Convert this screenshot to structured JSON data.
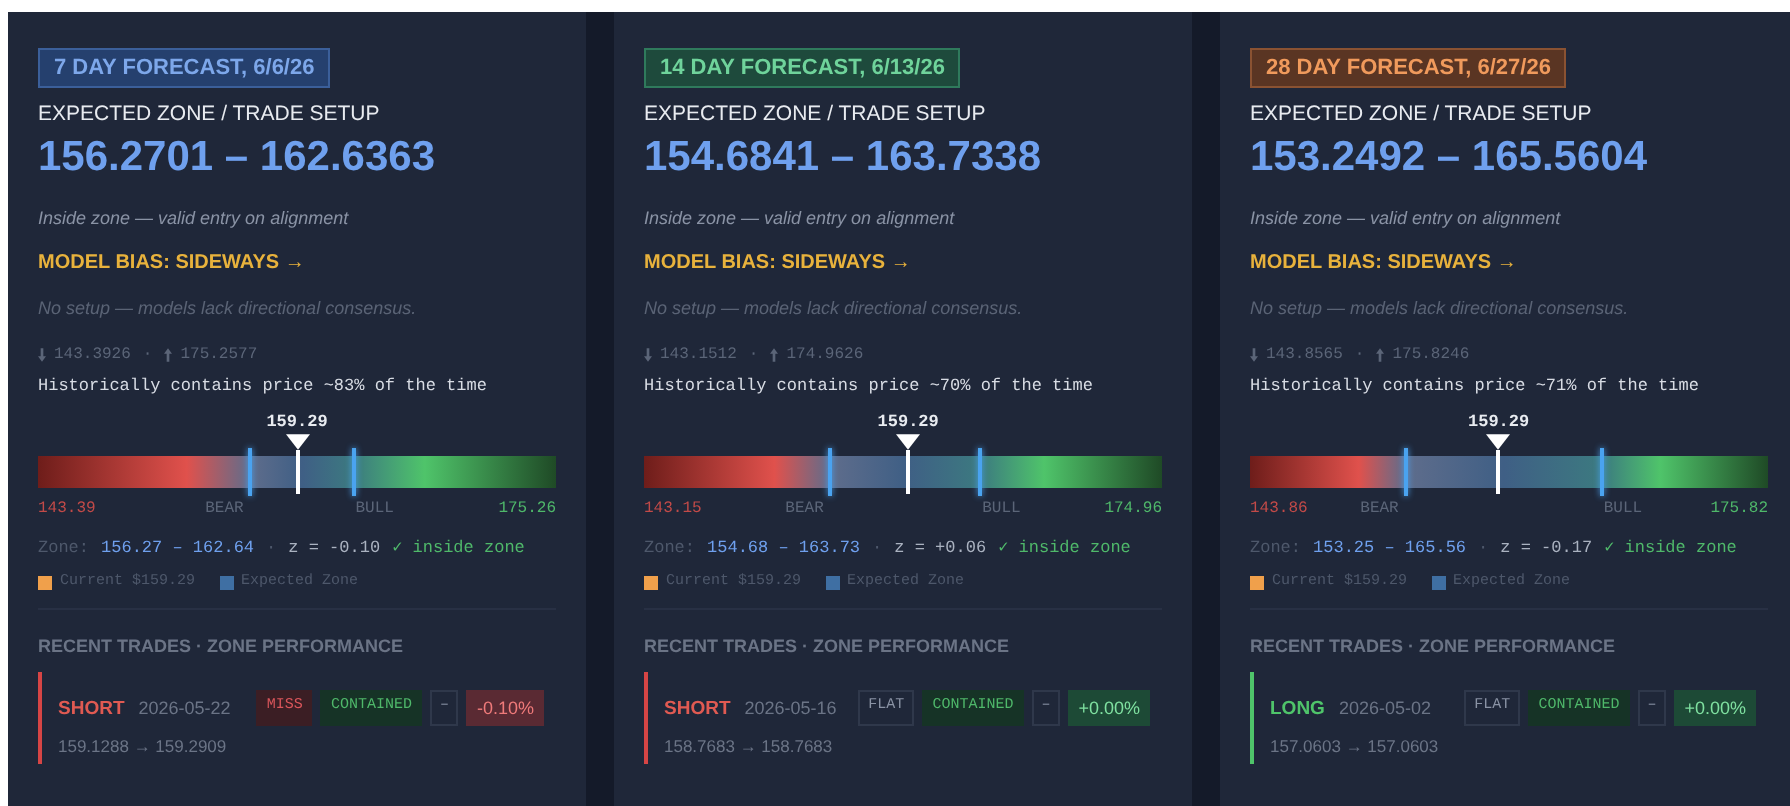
{
  "cards": [
    {
      "tag": {
        "label": "7 DAY FORECAST, 6/6/26",
        "kind": "blue"
      },
      "setup_label": "EXPECTED ZONE / TRADE SETUP",
      "zone_range": "156.2701 – 162.6363",
      "zone_note": "Inside zone — valid entry on alignment",
      "bias": "MODEL BIAS: SIDEWAYS →",
      "setup_note": "No setup — models lack directional consensus.",
      "low": "143.3926",
      "separator": "·",
      "high": "175.2577",
      "history": "Historically contains price ~83% of the time",
      "gauge": {
        "price_label": "159.29",
        "price": {
          "level": 0.5
        },
        "zone_low": {
          "level": 0.41
        },
        "zone_high": {
          "level": 0.61
        },
        "min_label": "143.39",
        "max_label": "175.26",
        "bear_label": "BEAR",
        "bull_label": "BULL"
      },
      "zone_line": {
        "label": "Zone:",
        "range": "156.27 – 162.64",
        "separator": "·",
        "z": "z = -0.10",
        "status": "✓ inside zone"
      },
      "legend": [
        {
          "label": "Current $159.29",
          "color": "#f0a04b"
        },
        {
          "label": "Expected Zone",
          "color": "#3f6fa3"
        }
      ],
      "trades_title": "RECENT TRADES · ZONE PERFORMANCE",
      "trades": [
        {
          "side": "SHORT",
          "kind": "short",
          "date": "2026-05-22",
          "prices": "159.1288 → 159.2909",
          "badges": [
            {
              "label": "MISS",
              "kind": "miss"
            },
            {
              "label": "CONTAINED",
              "kind": "contained"
            },
            {
              "label": "–",
              "kind": "neutral"
            },
            {
              "label": "-0.10%",
              "kind": "loss"
            }
          ]
        }
      ]
    },
    {
      "tag": {
        "label": "14 DAY FORECAST, 6/13/26",
        "kind": "green"
      },
      "setup_label": "EXPECTED ZONE / TRADE SETUP",
      "zone_range": "154.6841 – 163.7338",
      "zone_note": "Inside zone — valid entry on alignment",
      "bias": "MODEL BIAS: SIDEWAYS →",
      "setup_note": "No setup — models lack directional consensus.",
      "low": "143.1512",
      "separator": "·",
      "high": "174.9626",
      "history": "Historically contains price ~70% of the time",
      "gauge": {
        "price_label": "159.29",
        "price": {
          "level": 0.51
        },
        "zone_low": {
          "level": 0.36
        },
        "zone_high": {
          "level": 0.65
        },
        "min_label": "143.15",
        "max_label": "174.96",
        "bear_label": "BEAR",
        "bull_label": "BULL"
      },
      "zone_line": {
        "label": "Zone:",
        "range": "154.68 – 163.73",
        "separator": "·",
        "z": "z = +0.06",
        "status": "✓ inside zone"
      },
      "legend": [
        {
          "label": "Current $159.29",
          "color": "#f0a04b"
        },
        {
          "label": "Expected Zone",
          "color": "#3f6fa3"
        }
      ],
      "trades_title": "RECENT TRADES · ZONE PERFORMANCE",
      "trades": [
        {
          "side": "SHORT",
          "kind": "short",
          "date": "2026-05-16",
          "prices": "158.7683 → 158.7683",
          "badges": [
            {
              "label": "FLAT",
              "kind": "flat"
            },
            {
              "label": "CONTAINED",
              "kind": "contained"
            },
            {
              "label": "–",
              "kind": "neutral"
            },
            {
              "label": "+0.00%",
              "kind": "gain"
            }
          ]
        }
      ]
    },
    {
      "tag": {
        "label": "28 DAY FORECAST, 6/27/26",
        "kind": "orange"
      },
      "setup_label": "EXPECTED ZONE / TRADE SETUP",
      "zone_range": "153.2492 – 165.5604",
      "zone_note": "Inside zone — valid entry on alignment",
      "bias": "MODEL BIAS: SIDEWAYS →",
      "setup_note": "No setup — models lack directional consensus.",
      "low": "143.8565",
      "separator": "·",
      "high": "175.8246",
      "history": "Historically contains price ~71% of the time",
      "gauge": {
        "price_label": "159.29",
        "price": {
          "level": 0.48
        },
        "zone_low": {
          "level": 0.3
        },
        "zone_high": {
          "level": 0.68
        },
        "min_label": "143.86",
        "max_label": "175.82",
        "bear_label": "BEAR",
        "bull_label": "BULL"
      },
      "zone_line": {
        "label": "Zone:",
        "range": "153.25 – 165.56",
        "separator": "·",
        "z": "z = -0.17",
        "status": "✓ inside zone"
      },
      "legend": [
        {
          "label": "Current $159.29",
          "color": "#f0a04b"
        },
        {
          "label": "Expected Zone",
          "color": "#3f6fa3"
        }
      ],
      "trades_title": "RECENT TRADES · ZONE PERFORMANCE",
      "trades": [
        {
          "side": "LONG",
          "kind": "long",
          "date": "2026-05-02",
          "prices": "157.0603 → 157.0603",
          "badges": [
            {
              "label": "FLAT",
              "kind": "flat"
            },
            {
              "label": "CONTAINED",
              "kind": "contained"
            },
            {
              "label": "–",
              "kind": "neutral"
            },
            {
              "label": "+0.00%",
              "kind": "gain"
            }
          ]
        }
      ]
    }
  ]
}
